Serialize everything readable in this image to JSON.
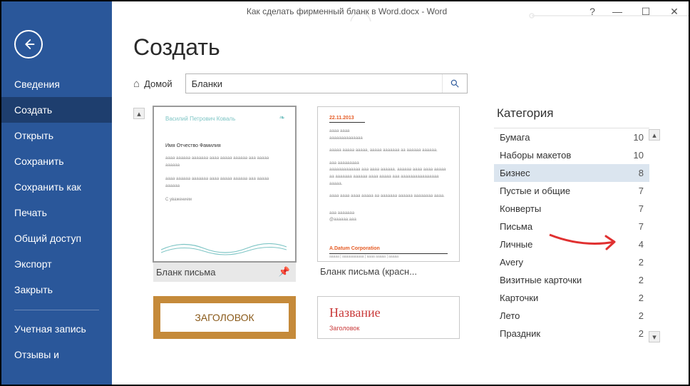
{
  "titlebar": {
    "document_title": "Как сделать фирменный бланк в Word.docx  -  Word",
    "help": "?",
    "min": "—",
    "max": "☐",
    "close": "✕"
  },
  "sidebar": {
    "items": [
      {
        "label": "Сведения"
      },
      {
        "label": "Создать"
      },
      {
        "label": "Открыть"
      },
      {
        "label": "Сохранить"
      },
      {
        "label": "Сохранить как"
      },
      {
        "label": "Печать"
      },
      {
        "label": "Общий доступ"
      },
      {
        "label": "Экспорт"
      },
      {
        "label": "Закрыть"
      }
    ],
    "footer_items": [
      {
        "label": "Учетная запись"
      },
      {
        "label": "Отзывы и"
      }
    ]
  },
  "main": {
    "heading": "Создать",
    "home_label": "Домой",
    "search_value": "Бланки"
  },
  "templates": {
    "row1": [
      {
        "label": "Бланк письма",
        "selected": true,
        "thumb": {
          "name": "Василий Петрович Коваль",
          "recipient": "Имя Отчество Фамилия",
          "body": "аааа аааааа ааааааа аааа ааааа аааааа ааа ааааа аааааа",
          "sign": "С уважением"
        }
      },
      {
        "label": "Бланк письма (красн...",
        "selected": false,
        "thumb": {
          "date": "22.11.2013",
          "foot": "A.Datum Corporation"
        }
      }
    ],
    "row2": [
      {
        "thumb_title": "ЗАГОЛОВОК"
      },
      {
        "thumb_title": "Название",
        "thumb_sub": "Заголовок"
      }
    ]
  },
  "categories": {
    "title": "Категория",
    "items": [
      {
        "name": "Бумага",
        "count": "10"
      },
      {
        "name": "Наборы макетов",
        "count": "10"
      },
      {
        "name": "Бизнес",
        "count": "8",
        "selected": true
      },
      {
        "name": "Пустые и общие",
        "count": "7"
      },
      {
        "name": "Конверты",
        "count": "7"
      },
      {
        "name": "Письма",
        "count": "7"
      },
      {
        "name": "Личные",
        "count": "4"
      },
      {
        "name": "Avery",
        "count": "2"
      },
      {
        "name": "Визитные карточки",
        "count": "2"
      },
      {
        "name": "Карточки",
        "count": "2"
      },
      {
        "name": "Лето",
        "count": "2"
      },
      {
        "name": "Праздник",
        "count": "2"
      }
    ]
  }
}
